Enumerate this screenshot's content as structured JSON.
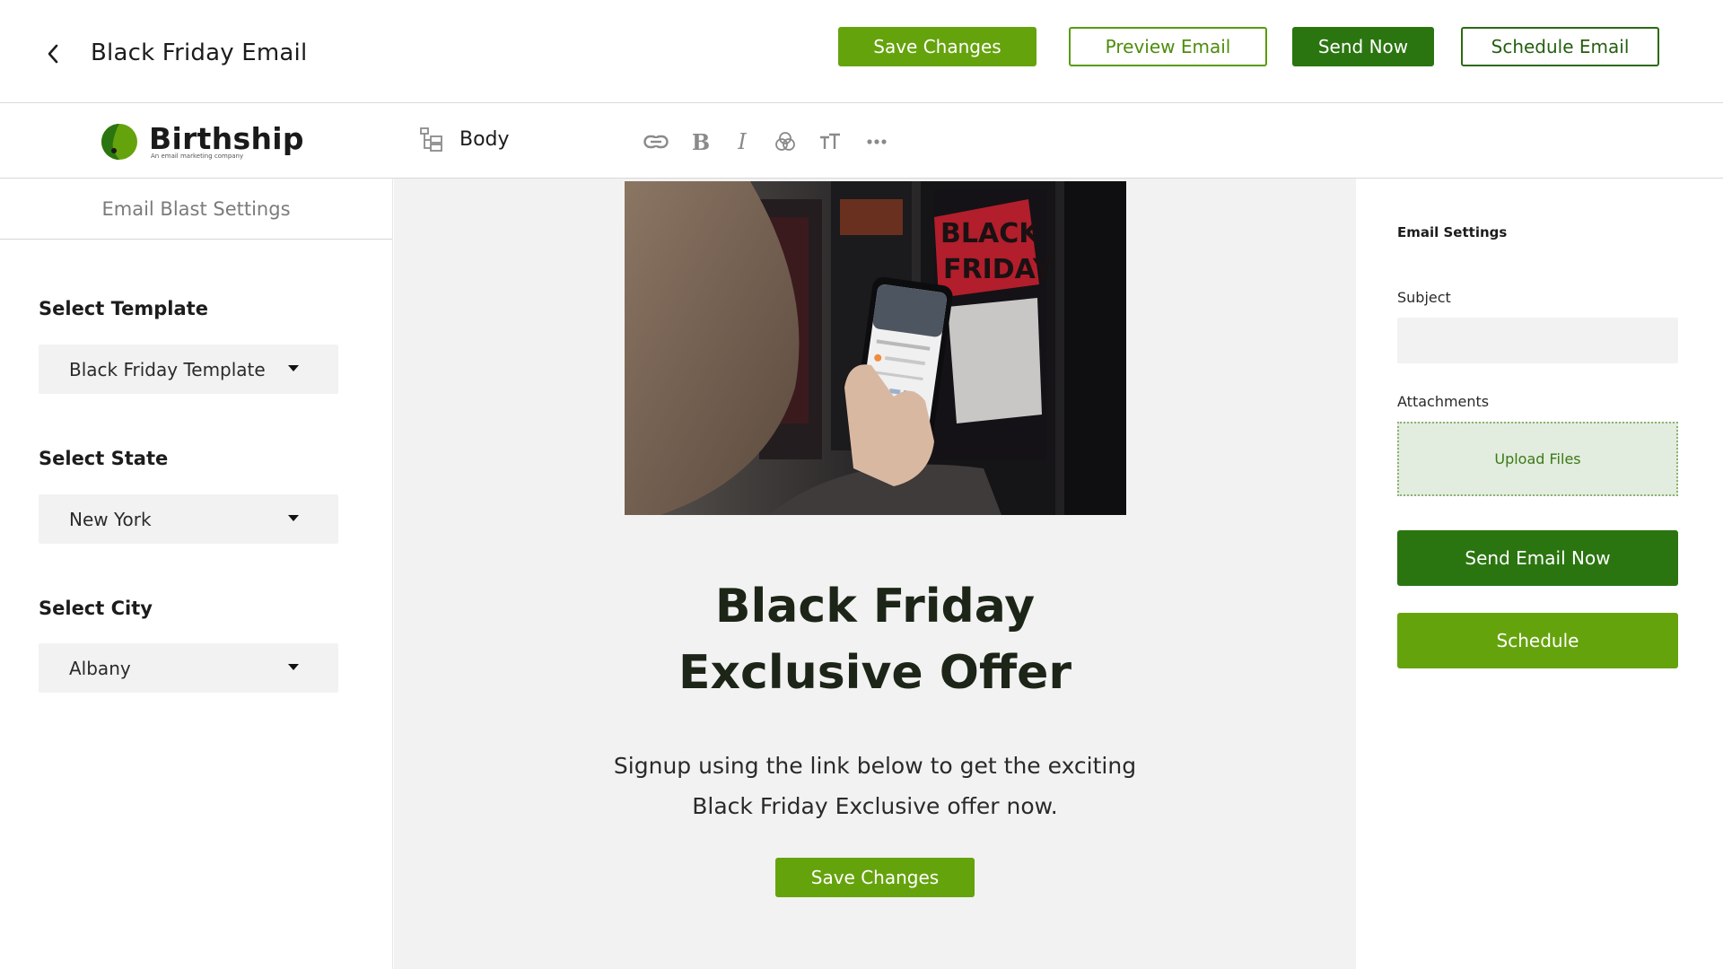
{
  "header": {
    "title": "Black Friday Email",
    "buttons": {
      "save": "Save Changes",
      "preview": "Preview Email",
      "send": "Send Now",
      "schedule": "Schedule Email"
    }
  },
  "brand": {
    "name": "Birthship",
    "tagline": "An email marketing company",
    "color": "#65a30d"
  },
  "toolbar": {
    "section_label": "Body",
    "tools": [
      "link-icon",
      "bold-icon",
      "italic-icon",
      "color-blend-icon",
      "text-size-icon",
      "more-icon"
    ]
  },
  "left_panel": {
    "header": "Email Blast Settings",
    "fields": [
      {
        "label": "Select Template",
        "value": "Black Friday Template"
      },
      {
        "label": "Select State",
        "value": "New York"
      },
      {
        "label": "Select City",
        "value": "Albany"
      }
    ]
  },
  "email": {
    "headline_line1": "Black Friday",
    "headline_line2": "Exclusive Offer",
    "body_line1": "Signup using the link below to get the exciting",
    "body_line2": "Black Friday Exclusive offer now.",
    "cta": "Save Changes",
    "hero_sign_1": "BLACK",
    "hero_sign_2": "FRIDAY"
  },
  "right_panel": {
    "title": "Email Settings",
    "subject_label": "Subject",
    "subject_value": "",
    "attachments_label": "Attachments",
    "upload_label": "Upload Files",
    "send_now": "Send Email Now",
    "schedule": "Schedule"
  },
  "colors": {
    "primary_green": "#65a30d",
    "dark_green": "#2b7510",
    "upload_bg": "#e2ecdf",
    "canvas_bg": "#f2f2f2"
  }
}
